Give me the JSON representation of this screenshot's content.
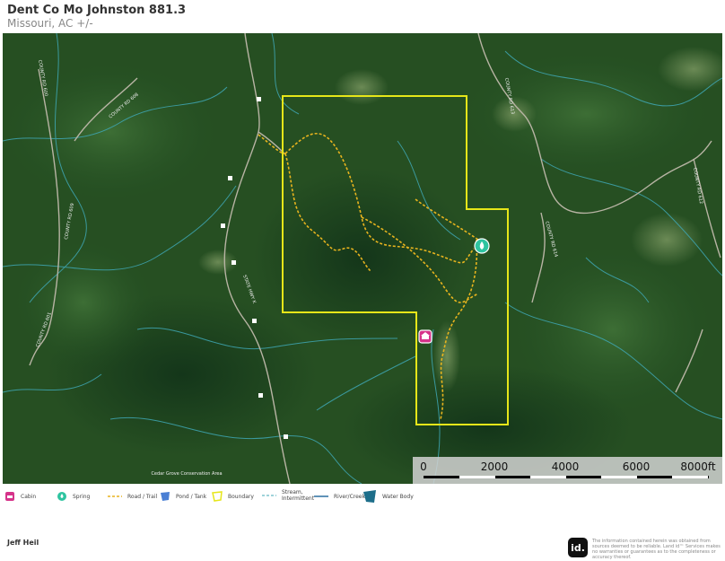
{
  "header": {
    "title": "Dent Co Mo Johnston 881.3",
    "subtitle": "Missouri,  AC +/-"
  },
  "map": {
    "road_labels": [
      "COUNTY RD 600",
      "COUNTY RD 608",
      "COUNTY RD 609",
      "COUNTY RD 613",
      "STATE HWY K",
      "COUNTY RD 612",
      "COUNTY RD 614",
      "COUNTY RD 601"
    ],
    "area_label": "Cedar Grove Conservation Area",
    "colors": {
      "boundary": "#e6e619",
      "trail": "#e8b41e",
      "stream": "#3fa7b4",
      "cabin": "#d6338a",
      "spring": "#2ec4a0"
    }
  },
  "scale": {
    "labels": [
      "0",
      "2000",
      "4000",
      "6000",
      "8000ft"
    ]
  },
  "legend": {
    "items": [
      {
        "icon": "cabin-icon",
        "label": "Cabin"
      },
      {
        "icon": "spring-icon",
        "label": "Spring"
      },
      {
        "icon": "road-trail-icon",
        "label": "Road / Trail"
      },
      {
        "icon": "pond-tank-icon",
        "label": "Pond / Tank"
      },
      {
        "icon": "boundary-icon",
        "label": "Boundary"
      },
      {
        "icon": "stream-intermittent-icon",
        "label": "Stream, Intermittent"
      },
      {
        "icon": "river-creek-icon",
        "label": "River/Creek"
      },
      {
        "icon": "water-body-icon",
        "label": "Water Body"
      }
    ]
  },
  "footer": {
    "agent": "Jeff Heil",
    "logo_text": "id.",
    "disclaimer": "The information contained herein was obtained from sources deemed to be reliable. Land id™ Services makes no warranties or guarantees as to the completeness or accuracy thereof."
  }
}
